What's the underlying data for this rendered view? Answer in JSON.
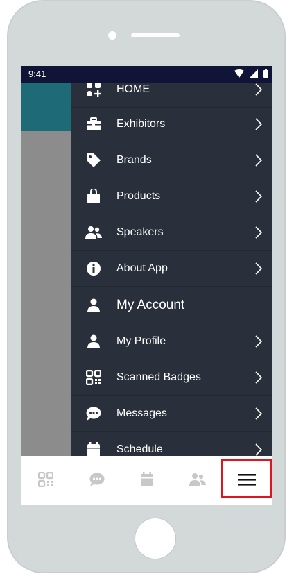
{
  "status_bar": {
    "time": "9:41"
  },
  "drawer": {
    "items": [
      {
        "label": "HOME",
        "icon": "apps-add-icon"
      },
      {
        "label": "Exhibitors",
        "icon": "briefcase-icon"
      },
      {
        "label": "Brands",
        "icon": "tag-icon"
      },
      {
        "label": "Products",
        "icon": "shopping-bag-icon"
      },
      {
        "label": "Speakers",
        "icon": "users-icon"
      },
      {
        "label": "About App",
        "icon": "info-icon"
      }
    ],
    "section_title": "My Account",
    "account_items": [
      {
        "label": "My Profile",
        "icon": "user-icon"
      },
      {
        "label": "Scanned Badges",
        "icon": "qr-code-icon"
      },
      {
        "label": "Messages",
        "icon": "chat-icon"
      },
      {
        "label": "Schedule",
        "icon": "calendar-icon"
      }
    ]
  },
  "tab_bar": {
    "tabs": [
      "qr-code-icon",
      "chat-icon",
      "calendar-icon",
      "users-icon",
      "hamburger-menu-icon"
    ],
    "highlight_color": "#e0141e"
  },
  "colors": {
    "drawer_bg": "#2a2f3c",
    "status_bar_bg": "#101436",
    "header_teal": "#1e6a76"
  }
}
